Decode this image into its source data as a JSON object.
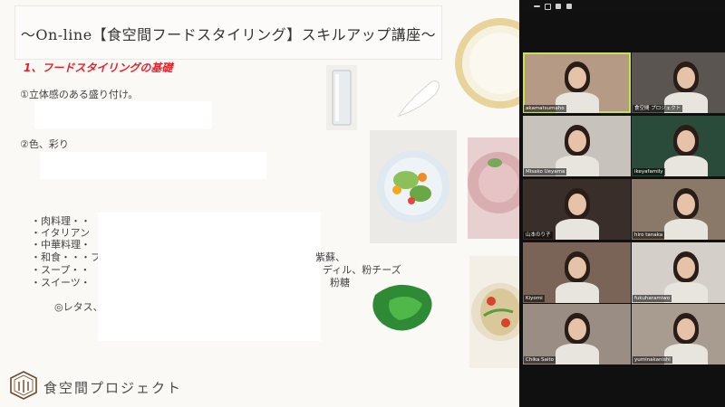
{
  "slide": {
    "title": "～On-line【食空間フードスタイリング】スキルアップ講座～",
    "section_heading": "1、フードスタイリングの基礎",
    "item1": "①立体感のある盛り付け。",
    "item2": "②色、彩り",
    "list": [
      "・肉料理・・",
      "・イタリアン",
      "・中華料理・",
      "・和食・・・フ",
      "・スープ・・",
      "・スイーツ・"
    ],
    "fragment_1": "紫蘇、",
    "fragment_2": "ディル、粉チーズ",
    "fragment_3": "粉糖",
    "note": "◎レタス、",
    "logo_text": "食空間プロジェクト"
  },
  "gallery": {
    "participants": [
      {
        "name": "akamatsumaho",
        "active": true,
        "bg": "#b59a86"
      },
      {
        "name": "食空間 プロジェクト",
        "active": false,
        "bg": "#5a5550"
      },
      {
        "name": "Misako Ueyama",
        "active": false,
        "bg": "#c8c2bc"
      },
      {
        "name": "ikeyafamily",
        "active": false,
        "bg": "#2a4a3a"
      },
      {
        "name": "山本のり子",
        "active": false,
        "bg": "#3a2e2a"
      },
      {
        "name": "hiro tanaka",
        "active": false,
        "bg": "#8a7868"
      },
      {
        "name": "Kiyomi",
        "active": false,
        "bg": "#7a6458"
      },
      {
        "name": "fukuharamiwo",
        "active": false,
        "bg": "#d4cfc8"
      },
      {
        "name": "Chika Saito",
        "active": false,
        "bg": "#9a8e84"
      },
      {
        "name": "yuminakanishi",
        "active": false,
        "bg": "#a89c90"
      }
    ]
  }
}
